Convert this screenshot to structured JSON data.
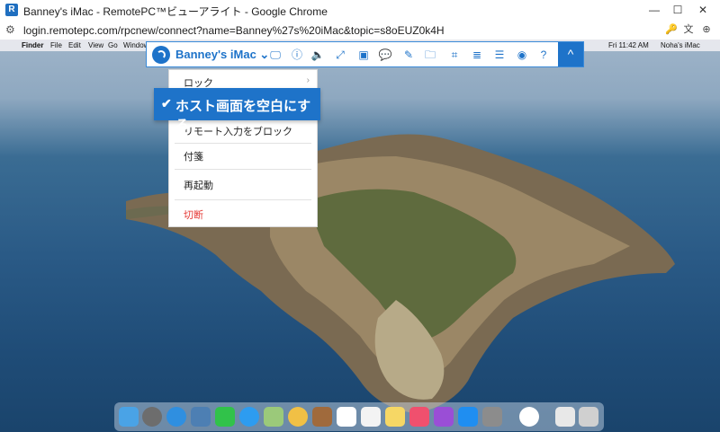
{
  "browser": {
    "title": "Banney's iMac - RemotePC™ビューアライト - Google Chrome",
    "favicon_letter": "R",
    "url": "login.remotepc.com/rpcnew/connect?name=Banney%27s%20iMac&topic=s8oEUZ0k4H",
    "window_buttons": [
      "minimize-icon",
      "maximize-icon",
      "close-icon"
    ]
  },
  "mac": {
    "menubar_items": [
      "Finder",
      "File",
      "Edit",
      "View",
      "Go",
      "Window"
    ],
    "clock": "Fri 11:42 AM",
    "user": "Noha's iMac"
  },
  "toolbar": {
    "host": "Banney's iMac",
    "icons": [
      "disconnect-screen-icon",
      "info-icon",
      "volume-icon",
      "expand-icon",
      "chat-icon",
      "messages-icon",
      "edit-icon",
      "file-transfer-icon",
      "camera-icon",
      "notes-icon",
      "menu-icon",
      "view-icon",
      "help-icon"
    ]
  },
  "menu": {
    "items": [
      {
        "label": "ロック",
        "has_submenu": true
      },
      {
        "label": "ホスト画面を空白にする",
        "checked": true
      },
      {
        "label": "リモート入力をブロック"
      },
      {
        "label": "付箋"
      },
      {
        "label": "再起動"
      },
      {
        "label": "切断",
        "danger": true
      }
    ]
  },
  "colors": {
    "accent": "#1e73c9",
    "danger": "#e53935"
  }
}
